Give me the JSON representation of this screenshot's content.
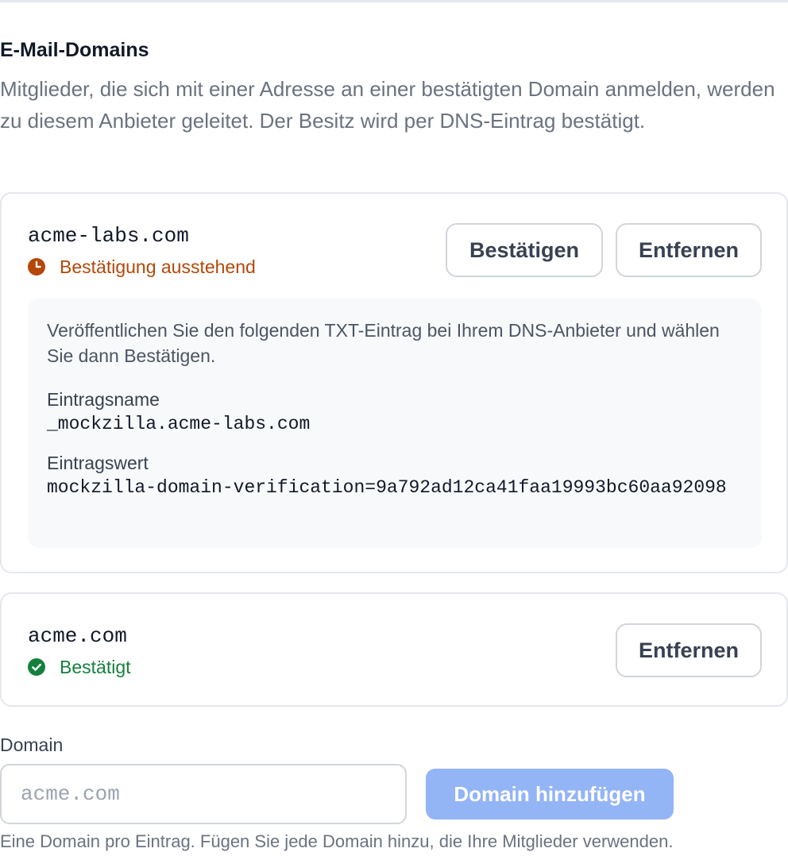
{
  "section": {
    "title": "E-Mail-Domains",
    "description": "Mitglieder, die sich mit einer Adresse an einer bestätigten Domain anmelden, werden zu diesem Anbieter geleitet. Der Besitz wird per DNS-Eintrag bestätigt."
  },
  "domains": [
    {
      "name": "acme-labs.com",
      "status": "Bestätigung ausstehend",
      "status_color": "#b54708",
      "status_icon": "clock-icon",
      "verify_label": "Bestätigen",
      "remove_label": "Entfernen",
      "instructions": {
        "text": "Veröffentlichen Sie den folgenden TXT-Eintrag bei Ihrem DNS-Anbieter und wählen Sie dann Bestätigen.",
        "record_name_label": "Eintragsname",
        "record_name_value": "_mockzilla.acme-labs.com",
        "record_value_label": "Eintragswert",
        "record_value_value": "mockzilla-domain-verification=9a792ad12ca41faa19993bc60aa92098"
      }
    },
    {
      "name": "acme.com",
      "status": "Bestätigt",
      "status_color": "#15803d",
      "status_icon": "check-circle-icon",
      "remove_label": "Entfernen"
    }
  ],
  "add_domain": {
    "label": "Domain",
    "placeholder": "acme.com",
    "value": "",
    "button_label": "Domain hinzufügen",
    "button_color": "#93b4f5",
    "helper": "Eine Domain pro Eintrag. Fügen Sie jede Domain hinzu, die Ihre Mitglieder verwenden."
  }
}
